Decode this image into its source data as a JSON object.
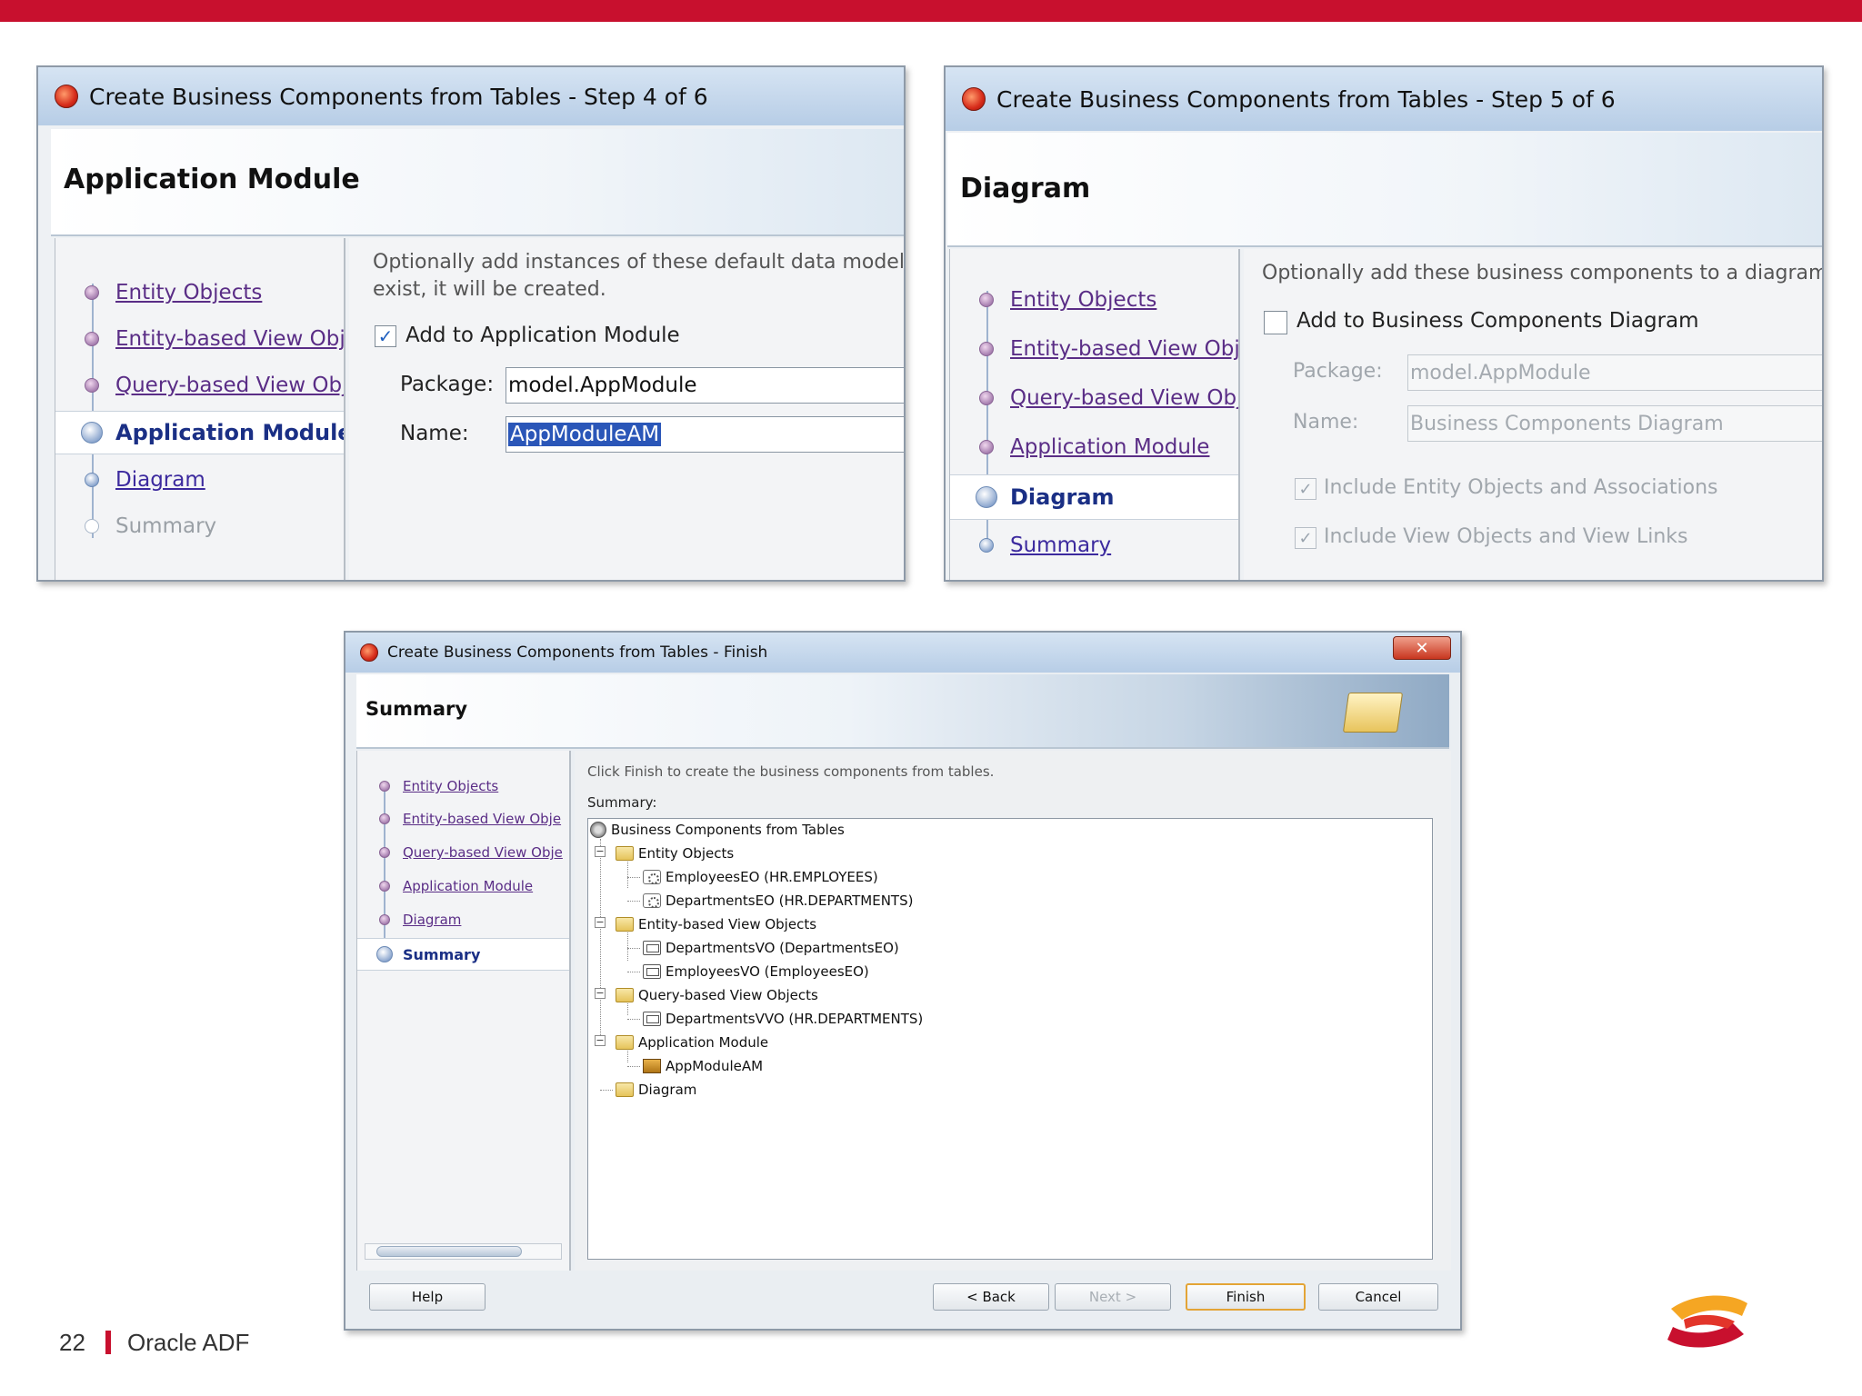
{
  "colors": {
    "brand_red": "#c8102e",
    "link_purple": "#5a2d86",
    "link_blue": "#3c2a9e",
    "selection_blue": "#2a56b8",
    "logo_orange": "#f5a623"
  },
  "step4": {
    "title": "Create Business Components from Tables - Step 4 of 6",
    "header": "Application Module",
    "nav": [
      "Entity Objects",
      "Entity-based View Obje",
      "Query-based View Obje",
      "Application Module",
      "Diagram",
      "Summary"
    ],
    "description_line1": "Optionally add instances of these default data model com",
    "description_line2": "exist, it will be created.",
    "checkbox_label": "Add to Application Module",
    "checkbox_checked": true,
    "package_label": "Package:",
    "package_value": "model.AppModule",
    "name_label": "Name:",
    "name_value": "AppModuleAM"
  },
  "step5": {
    "title": "Create Business Components from Tables - Step 5 of 6",
    "header": "Diagram",
    "nav": [
      "Entity Objects",
      "Entity-based View Obje",
      "Query-based View Obje",
      "Application Module",
      "Diagram",
      "Summary"
    ],
    "description": "Optionally add these business components to a diagram.  If",
    "checkbox_label": "Add to Business Components Diagram",
    "checkbox_checked": false,
    "package_label": "Package:",
    "package_value": "model.AppModule",
    "name_label": "Name:",
    "name_value": "Business Components Diagram",
    "include_entities": "Include Entity Objects and Associations",
    "include_views": "Include View Objects and View Links"
  },
  "finish": {
    "title": "Create Business Components from Tables - Finish",
    "close_icon": "close-icon",
    "header": "Summary",
    "nav": [
      "Entity Objects",
      "Entity-based View Obje",
      "Query-based View Obje",
      "Application Module",
      "Diagram",
      "Summary"
    ],
    "description": "Click Finish to create the business components from tables.",
    "summary_label": "Summary:",
    "tree": {
      "root": "Business Components from Tables",
      "entity_folder": "Entity Objects",
      "entity_items": [
        "EmployeesEO (HR.EMPLOYEES)",
        "DepartmentsEO (HR.DEPARTMENTS)"
      ],
      "entity_view_folder": "Entity-based View Objects",
      "entity_view_items": [
        "DepartmentsVO (DepartmentsEO)",
        "EmployeesVO (EmployeesEO)"
      ],
      "query_view_folder": "Query-based View Objects",
      "query_view_items": [
        "DepartmentsVVO (HR.DEPARTMENTS)"
      ],
      "app_module_folder": "Application Module",
      "app_module_items": [
        "AppModuleAM"
      ],
      "diagram_folder": "Diagram"
    },
    "buttons": {
      "help": "Help",
      "back": "< Back",
      "next": "Next >",
      "finish": "Finish",
      "cancel": "Cancel"
    }
  },
  "footer": {
    "page_number": "22",
    "title": "Oracle ADF"
  }
}
